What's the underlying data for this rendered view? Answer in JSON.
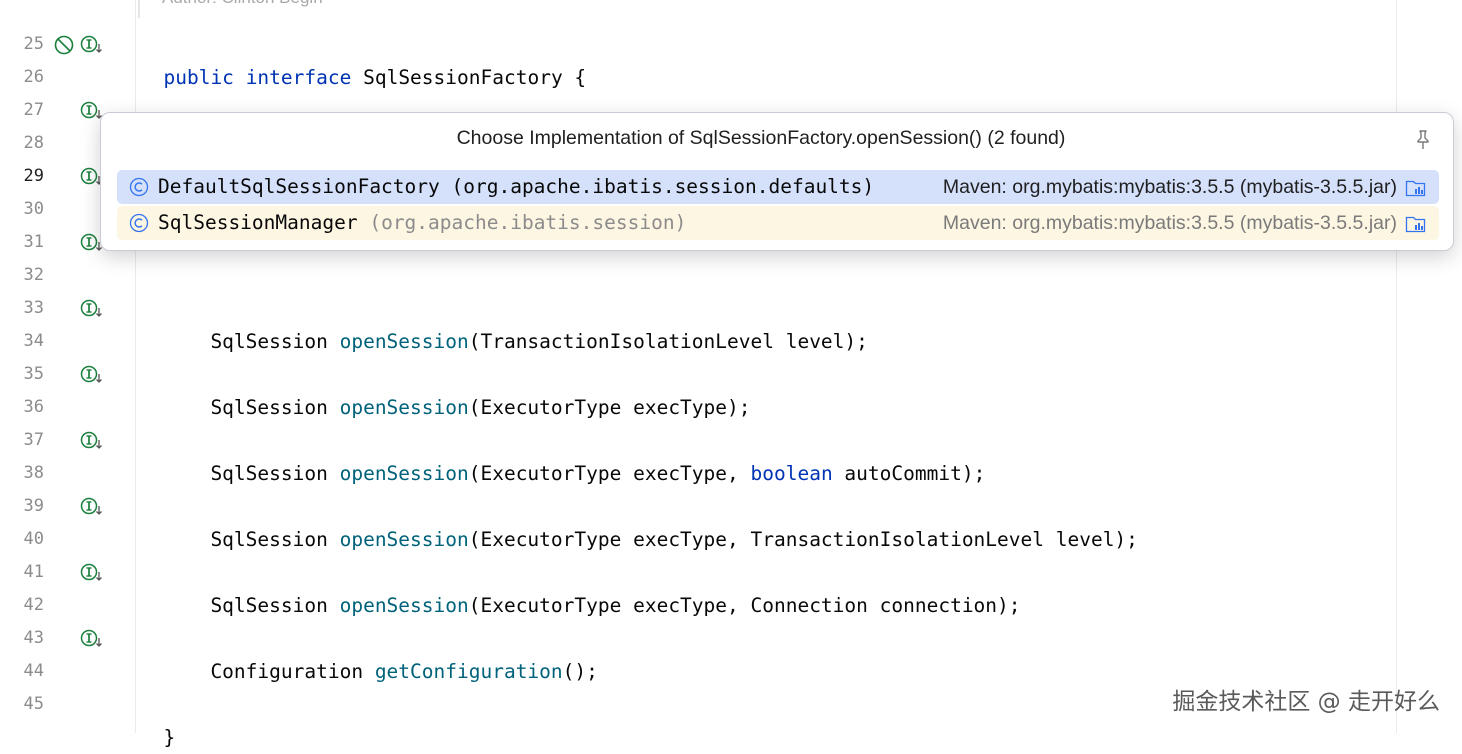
{
  "editor": {
    "author_comment": "Author: Clinton Begin",
    "line_numbers": [
      "25",
      "26",
      "27",
      "28",
      "29",
      "30",
      "31",
      "32",
      "33",
      "34",
      "35",
      "36",
      "37",
      "38",
      "39",
      "40",
      "41",
      "42",
      "43",
      "44",
      "45"
    ],
    "current_line": "29",
    "lines": {
      "l25": {
        "kw1": "public",
        "kw2": "interface",
        "rest": " SqlSessionFactory {"
      },
      "l27": {
        "type": "    SqlSession ",
        "fn": "openSession",
        "rest": "();"
      },
      "l33": {
        "type": "    SqlSession ",
        "fn": "openSession",
        "rest": "(TransactionIsolationLevel level);"
      },
      "l35": {
        "type": "    SqlSession ",
        "fn": "openSession",
        "rest": "(ExecutorType execType);"
      },
      "l37": {
        "type": "    SqlSession ",
        "fn": "openSession",
        "rest1": "(ExecutorType execType, ",
        "kw": "boolean",
        "rest2": " autoCommit);"
      },
      "l39": {
        "type": "    SqlSession ",
        "fn": "openSession",
        "rest": "(ExecutorType execType, TransactionIsolationLevel level);"
      },
      "l41": {
        "type": "    SqlSession ",
        "fn": "openSession",
        "rest": "(ExecutorType execType, Connection connection);"
      },
      "l43": {
        "type": "    Configuration ",
        "fn": "getConfiguration",
        "rest": "();"
      },
      "l45": {
        "rest": "}"
      }
    }
  },
  "popup": {
    "title": "Choose Implementation of SqlSessionFactory.openSession() (2 found)",
    "items": [
      {
        "class_name": "DefaultSqlSessionFactory",
        "package": " (org.apache.ibatis.session.defaults)",
        "source": "Maven: org.mybatis:mybatis:3.5.5 (mybatis-3.5.5.jar)"
      },
      {
        "class_name": "SqlSessionManager",
        "package": " (org.apache.ibatis.session)",
        "source": "Maven: org.mybatis:mybatis:3.5.5 (mybatis-3.5.5.jar)"
      }
    ]
  },
  "watermark": "掘金技术社区 @ 走开好么",
  "colors": {
    "keyword": "#0033b3",
    "method": "#00627a",
    "gutter_icon": "#1a7f3c",
    "selection": "#d5e1fb"
  }
}
